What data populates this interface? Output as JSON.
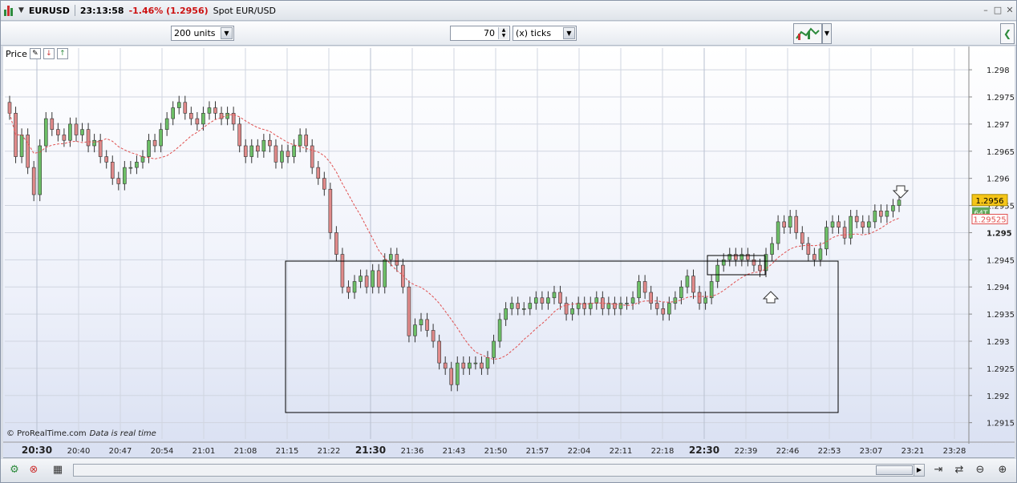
{
  "titlebar": {
    "symbol": "EURUSD",
    "time": "23:13:58",
    "change": "-1.46% (1.2956)",
    "instrument": "Spot EUR/USD"
  },
  "toolbar": {
    "units_value": "200 units",
    "ticks_value": "70",
    "ticks_unit": "(x) ticks"
  },
  "panel": {
    "price_label": "Price",
    "watermark": "© ProRealTime.com",
    "realtime_note": "Data is real time"
  },
  "colors": {
    "up_candle": "#6dbf67",
    "down_candle": "#e08a8a",
    "ma_line": "#e05050",
    "box": "#000000",
    "current_price_bg": "#f5c518",
    "volume_tag_bg": "#5fa85a",
    "grid": "#d0d5e0"
  },
  "chart_data": {
    "type": "candlestick",
    "x_ticks": [
      "20:30",
      "20:40",
      "20:47",
      "20:54",
      "21:01",
      "21:08",
      "21:15",
      "21:22",
      "21:30",
      "21:36",
      "21:43",
      "21:50",
      "21:57",
      "22:04",
      "22:11",
      "22:18",
      "22:30",
      "22:39",
      "22:46",
      "22:53",
      "23:07",
      "23:21",
      "23:28"
    ],
    "bold_x_ticks": [
      "20:30",
      "21:30",
      "22:30"
    ],
    "y_ticks": [
      "1.298",
      "1.2975",
      "1.297",
      "1.2965",
      "1.296",
      "1.2955",
      "1.295",
      "1.2945",
      "1.294",
      "1.2935",
      "1.293",
      "1.2925",
      "1.292",
      "1.2915"
    ],
    "ylim": [
      1.2912,
      1.2984
    ],
    "current_price_label": "1.2956",
    "ma_value_label": "1.29525",
    "volume_tag": "64T",
    "moving_average": "dashed",
    "closes": [
      1.2972,
      1.2964,
      1.2968,
      1.2962,
      1.2957,
      1.2966,
      1.2971,
      1.2969,
      1.2968,
      1.2967,
      1.297,
      1.2968,
      1.2969,
      1.2966,
      1.2967,
      1.2964,
      1.2963,
      1.296,
      1.2959,
      1.2962,
      1.2962,
      1.2963,
      1.2964,
      1.2967,
      1.2966,
      1.2969,
      1.2971,
      1.2973,
      1.2974,
      1.2972,
      1.2971,
      1.297,
      1.2972,
      1.2973,
      1.2972,
      1.2971,
      1.2972,
      1.297,
      1.2966,
      1.2964,
      1.2966,
      1.2965,
      1.2967,
      1.2966,
      1.2963,
      1.2965,
      1.2964,
      1.2966,
      1.2968,
      1.2966,
      1.2962,
      1.296,
      1.2958,
      1.295,
      1.2946,
      1.294,
      1.2939,
      1.2941,
      1.2942,
      1.294,
      1.2943,
      1.294,
      1.2945,
      1.2946,
      1.2944,
      1.294,
      1.2931,
      1.2933,
      1.2934,
      1.2932,
      1.293,
      1.2926,
      1.2925,
      1.2922,
      1.2926,
      1.2925,
      1.2926,
      1.2926,
      1.2925,
      1.2927,
      1.293,
      1.2934,
      1.2936,
      1.2937,
      1.2936,
      1.2936,
      1.2937,
      1.2938,
      1.2937,
      1.2938,
      1.2939,
      1.2937,
      1.2935,
      1.2936,
      1.2937,
      1.2936,
      1.2937,
      1.2938,
      1.2936,
      1.2937,
      1.2936,
      1.2937,
      1.2937,
      1.2938,
      1.2941,
      1.2939,
      1.2937,
      1.2936,
      1.2935,
      1.2937,
      1.2938,
      1.294,
      1.2942,
      1.2939,
      1.2937,
      1.2938,
      1.2941,
      1.2944,
      1.2945,
      1.2946,
      1.2945,
      1.2946,
      1.2945,
      1.2944,
      1.2943,
      1.2946,
      1.2948,
      1.2952,
      1.2951,
      1.2953,
      1.295,
      1.2948,
      1.2946,
      1.2945,
      1.2947,
      1.2951,
      1.2952,
      1.2951,
      1.2949,
      1.2953,
      1.2952,
      1.2951,
      1.2952,
      1.2954,
      1.2953,
      1.2954,
      1.2955,
      1.2956
    ]
  }
}
